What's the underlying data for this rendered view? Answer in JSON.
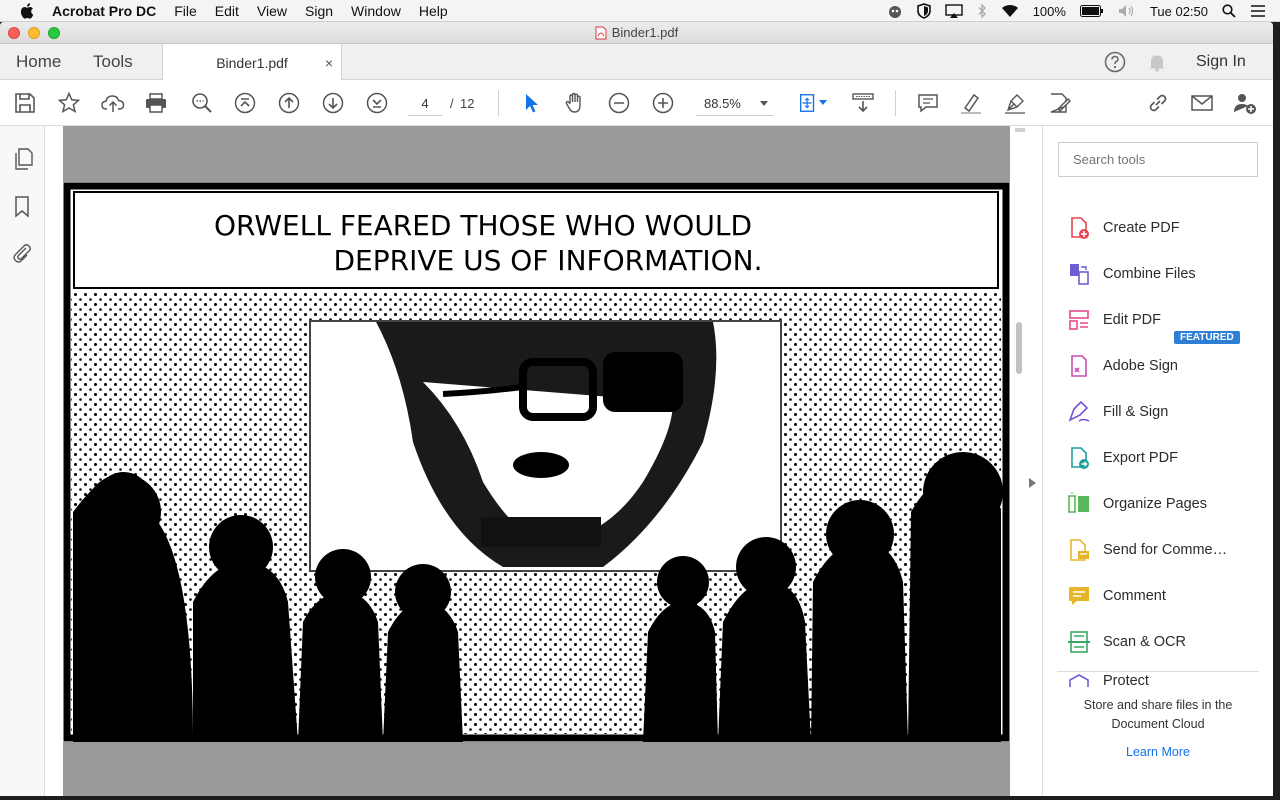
{
  "menubar": {
    "app_name": "Acrobat Pro DC",
    "menus": [
      "File",
      "Edit",
      "View",
      "Sign",
      "Window",
      "Help"
    ],
    "battery": "100%",
    "clock": "Tue 02:50"
  },
  "window": {
    "title": "Binder1.pdf"
  },
  "tabs": {
    "home": "Home",
    "tools": "Tools",
    "doc": "Binder1.pdf",
    "close": "×",
    "sign_in": "Sign In"
  },
  "toolbar": {
    "page_current": "4",
    "page_separator": "/",
    "page_total": "12",
    "zoom": "88.5%"
  },
  "document": {
    "comic_caption_line1": "ORWELL FEARED THOSE WHO WOULD",
    "comic_caption_line2": "DEPRIVE US OF INFORMATION."
  },
  "right_panel": {
    "search_placeholder": "Search tools",
    "featured_badge": "FEATURED",
    "tools": [
      {
        "label": "Create PDF",
        "icon": "create-pdf-icon",
        "color": "#e8434f"
      },
      {
        "label": "Combine Files",
        "icon": "combine-files-icon",
        "color": "#6c5fd6"
      },
      {
        "label": "Edit PDF",
        "icon": "edit-pdf-icon",
        "color": "#e54a8c"
      },
      {
        "label": "Adobe Sign",
        "icon": "adobe-sign-icon",
        "color": "#c94fb0"
      },
      {
        "label": "Fill & Sign",
        "icon": "fill-sign-icon",
        "color": "#7b4fd6"
      },
      {
        "label": "Export PDF",
        "icon": "export-pdf-icon",
        "color": "#1f9e9e"
      },
      {
        "label": "Organize Pages",
        "icon": "organize-pages-icon",
        "color": "#5cb85c"
      },
      {
        "label": "Send for Comme…",
        "icon": "send-for-comment-icon",
        "color": "#e5b52a"
      },
      {
        "label": "Comment",
        "icon": "comment-icon",
        "color": "#e5b52a"
      },
      {
        "label": "Scan & OCR",
        "icon": "scan-ocr-icon",
        "color": "#3aa864"
      },
      {
        "label": "Protect",
        "icon": "protect-icon",
        "color": "#6c5fd6"
      }
    ],
    "cloud_text_line1": "Store and share files in the",
    "cloud_text_line2": "Document Cloud",
    "learn_more": "Learn More"
  },
  "colors": {
    "accent_blue": "#1473e6",
    "featured_blue": "#2d7fd6",
    "page_gray": "#9a9a9a"
  }
}
